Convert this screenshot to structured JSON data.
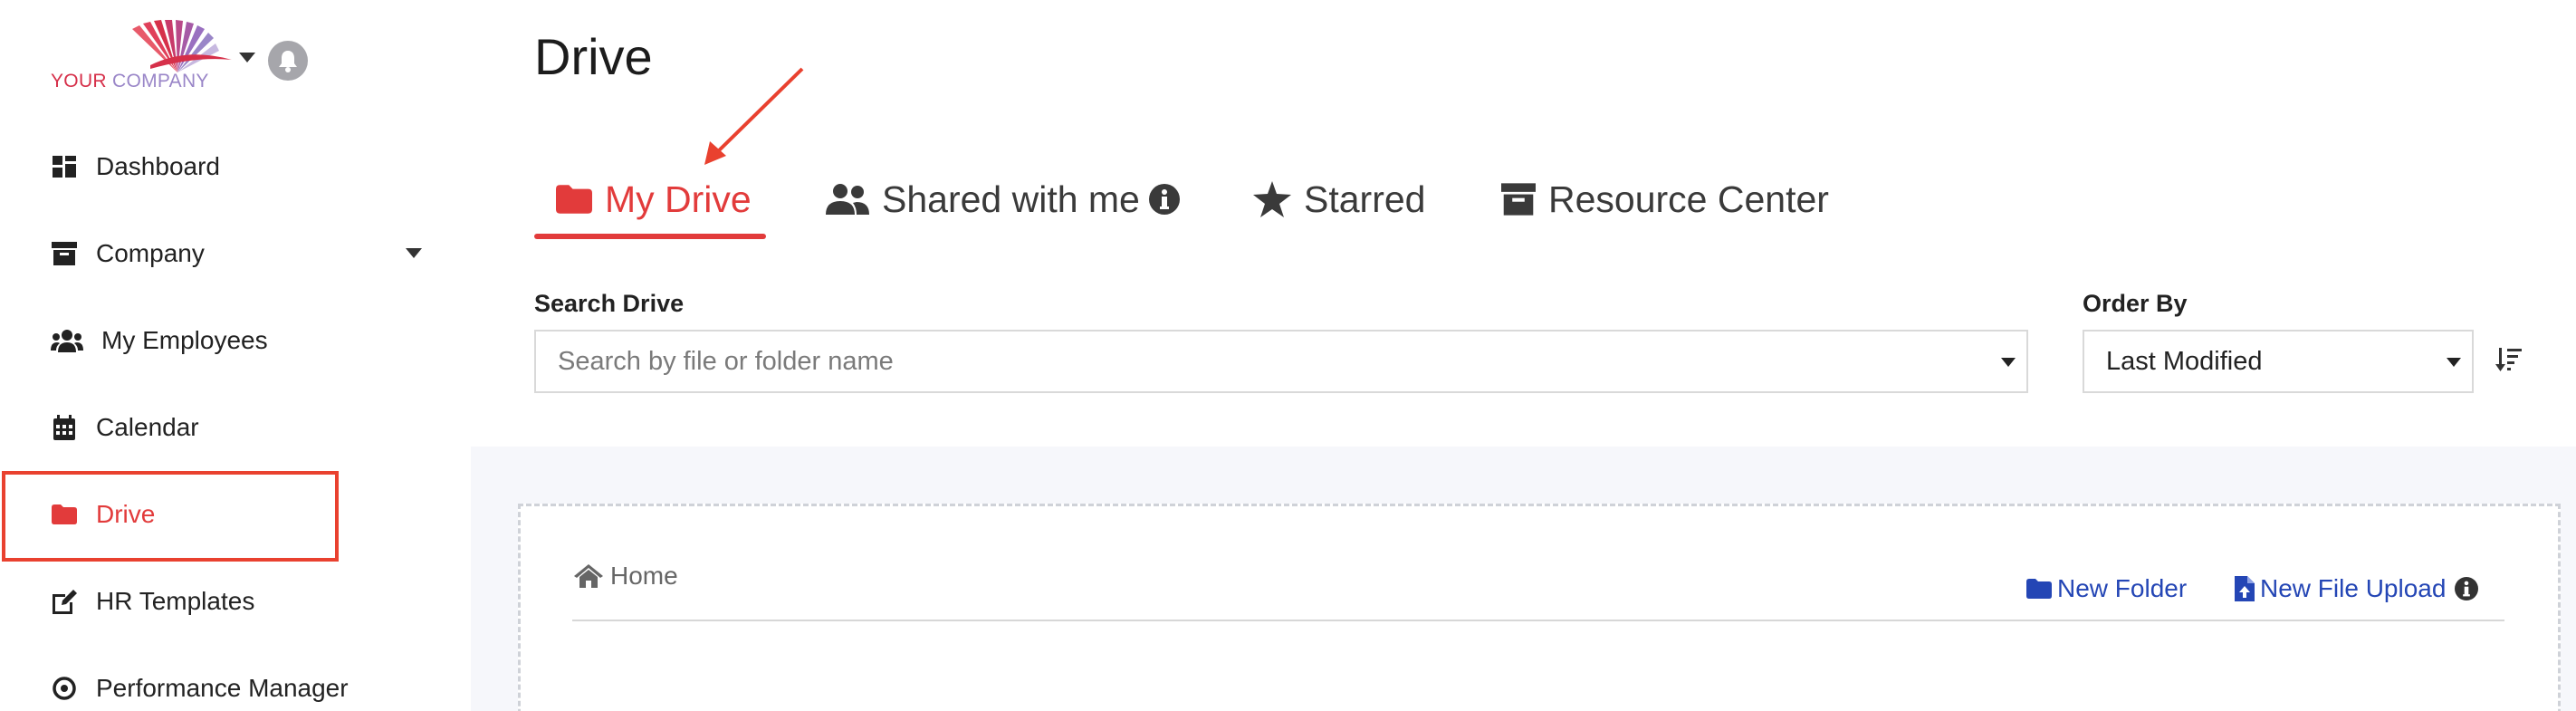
{
  "logo": {
    "word1": "YOUR",
    "word2": "COMPANY"
  },
  "sidebar": {
    "items": [
      {
        "label": "Dashboard",
        "icon": "grid-icon"
      },
      {
        "label": "Company",
        "icon": "archive-icon"
      },
      {
        "label": "My Employees",
        "icon": "users-icon"
      },
      {
        "label": "Calendar",
        "icon": "calendar-icon"
      },
      {
        "label": "Drive",
        "icon": "folder-icon",
        "active": true
      },
      {
        "label": "HR Templates",
        "icon": "edit-icon"
      },
      {
        "label": "Performance Manager",
        "icon": "target-icon"
      }
    ]
  },
  "page": {
    "title": "Drive"
  },
  "tabs": [
    {
      "label": "My Drive",
      "icon": "folder-icon",
      "active": true
    },
    {
      "label": "Shared with me",
      "icon": "users-icon"
    },
    {
      "label": "Starred",
      "icon": "star-icon"
    },
    {
      "label": "Resource Center",
      "icon": "archive-icon"
    }
  ],
  "search": {
    "label": "Search Drive",
    "placeholder": "Search by file or folder name"
  },
  "order": {
    "label": "Order By",
    "value": "Last Modified"
  },
  "breadcrumb": {
    "home": "Home"
  },
  "actions": {
    "new_folder": "New Folder",
    "new_file_upload": "New File Upload"
  },
  "colors": {
    "accent": "#e23b3b",
    "link": "#2446b5",
    "highlight": "#e9412f"
  }
}
